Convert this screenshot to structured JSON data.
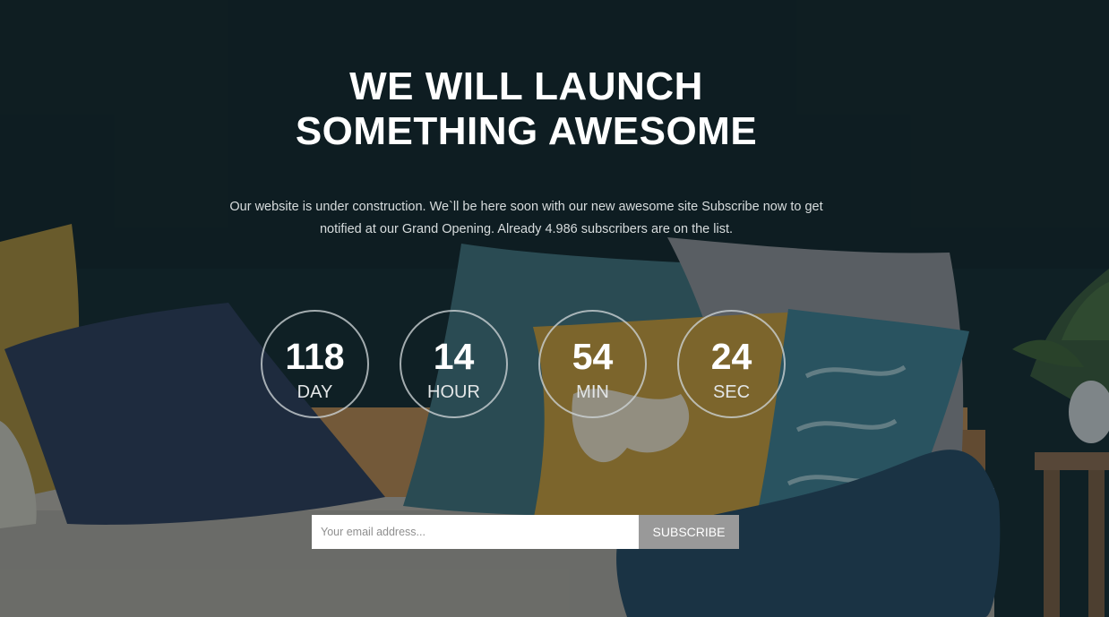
{
  "headline": {
    "line1": "WE WILL LAUNCH",
    "line2": "SOMETHING AWESOME"
  },
  "description": "Our website is under construction. We`ll be here soon with our new awesome site Subscribe now to get notified at our Grand Opening. Already 4.986 subscribers are on the list.",
  "countdown": [
    {
      "value": "118",
      "unit": "DAY"
    },
    {
      "value": "14",
      "unit": "HOUR"
    },
    {
      "value": "54",
      "unit": "MIN"
    },
    {
      "value": "24",
      "unit": "SEC"
    }
  ],
  "subscribe": {
    "placeholder": "Your email address...",
    "button_label": "SUBSCRIBE"
  },
  "colors": {
    "background": "#16282d",
    "text": "#ffffff",
    "button": "#999999"
  }
}
